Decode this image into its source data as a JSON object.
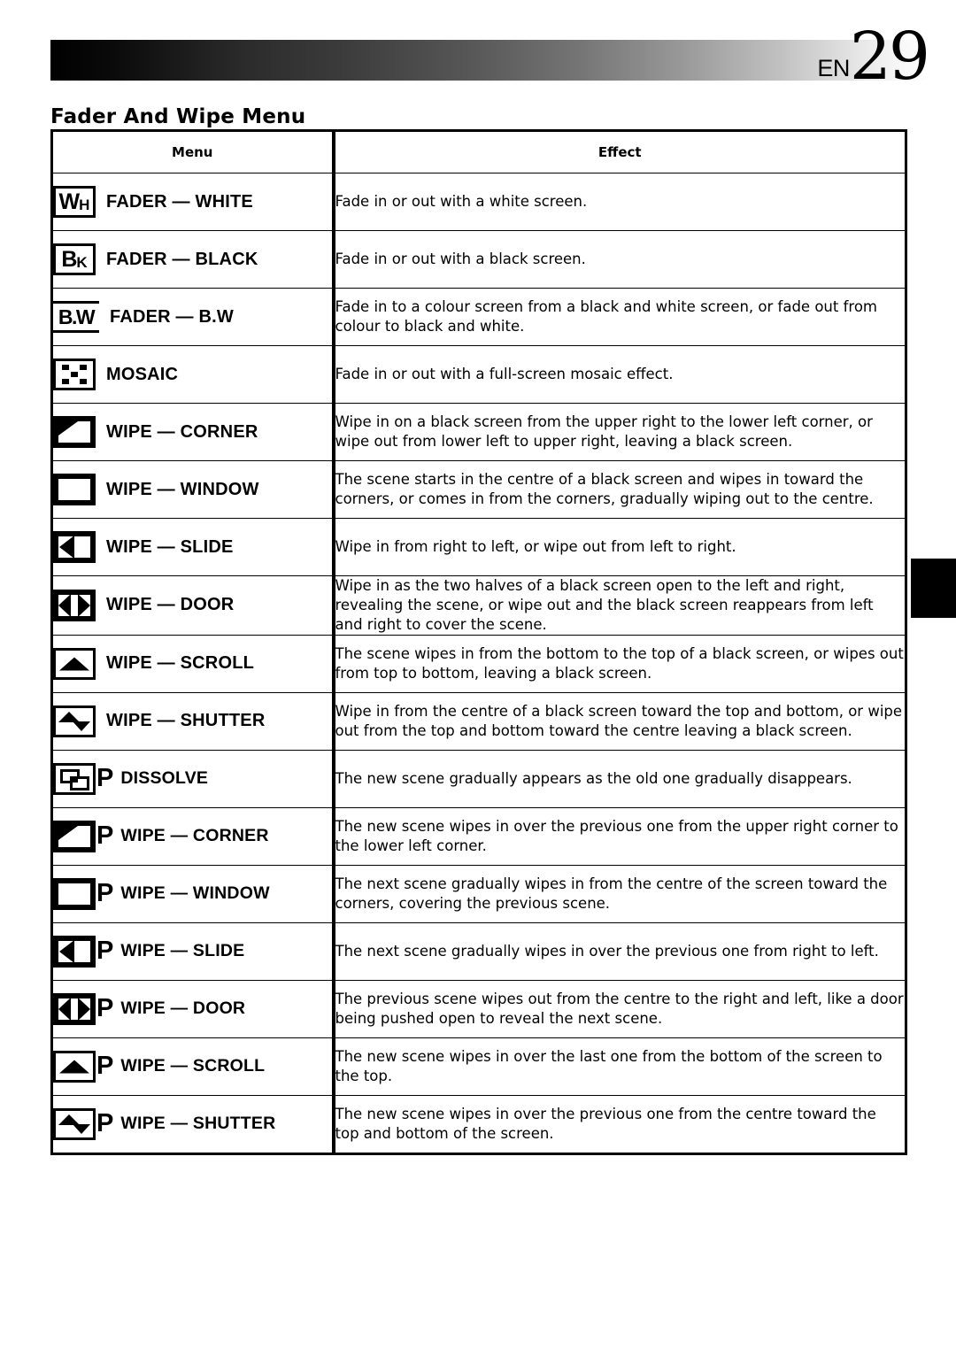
{
  "header": {
    "lang_code": "EN",
    "page_number": "29"
  },
  "section_title": "Fader And Wipe Menu",
  "table": {
    "columns": {
      "menu": "Menu",
      "effect": "Effect"
    },
    "rows": [
      {
        "icon": "wh-box-icon",
        "label": "FADER — WHITE",
        "effect": "Fade in or out with a white screen."
      },
      {
        "icon": "bk-box-icon",
        "label": "FADER — BLACK",
        "effect": "Fade in or out with a black screen."
      },
      {
        "icon": "bw-rules-icon",
        "label": "FADER — B.W",
        "effect": "Fade in to a colour screen from a black and white screen, or fade out from colour to black and white."
      },
      {
        "icon": "mosaic-checker-icon",
        "label": "MOSAIC",
        "effect": "Fade in or out with a full-screen mosaic effect."
      },
      {
        "icon": "wipe-corner-icon",
        "label": "WIPE — CORNER",
        "effect": "Wipe in on a black screen from the upper right to the lower left corner, or wipe out from lower left to upper right, leaving a black screen."
      },
      {
        "icon": "wipe-window-icon",
        "label": "WIPE — WINDOW",
        "effect": "The scene starts in the centre of a black screen and wipes in toward the corners, or comes in from the corners, gradually wiping out to the centre."
      },
      {
        "icon": "wipe-slide-icon",
        "label": "WIPE — SLIDE",
        "effect": "Wipe in from right to left, or wipe out from left to right."
      },
      {
        "icon": "wipe-door-icon",
        "label": "WIPE — DOOR",
        "effect": "Wipe in as the two halves of a black screen open to the left and right, revealing the scene, or wipe out and the black screen reappears from left and right to cover the scene."
      },
      {
        "icon": "wipe-scroll-icon",
        "label": "WIPE — SCROLL",
        "effect": "The scene wipes in from the bottom to the top of a black screen, or wipes out from top to bottom, leaving a black screen."
      },
      {
        "icon": "wipe-shutter-icon",
        "label": "WIPE — SHUTTER",
        "effect": "Wipe in from the centre of a black screen toward the top and bottom, or wipe out from the top and bottom toward the centre leaving a black screen."
      },
      {
        "icon": "dissolve-icon",
        "p_mark": "P",
        "label": "DISSOLVE",
        "effect": "The new scene gradually appears as the old one gradually disappears."
      },
      {
        "icon": "wipe-corner-icon",
        "p_mark": "P",
        "label": "WIPE — CORNER",
        "effect": "The new scene wipes in over the previous one from the upper right corner to the lower left corner."
      },
      {
        "icon": "wipe-window-icon",
        "p_mark": "P",
        "label": "WIPE — WINDOW",
        "effect": "The next scene gradually wipes in from the centre of the screen toward the corners, covering the previous scene."
      },
      {
        "icon": "wipe-slide-icon",
        "p_mark": "P",
        "label": "WIPE — SLIDE",
        "effect": "The next scene gradually wipes in over the previous one from right to left."
      },
      {
        "icon": "wipe-door-icon",
        "p_mark": "P",
        "label": "WIPE — DOOR",
        "effect": "The previous scene wipes out from the centre to the right and left, like a door being pushed open to reveal the next scene."
      },
      {
        "icon": "wipe-scroll-icon",
        "p_mark": "P",
        "label": "WIPE — SCROLL",
        "effect": "The new scene wipes in over the last one from the bottom of the screen to the top."
      },
      {
        "icon": "wipe-shutter-icon",
        "p_mark": "P",
        "label": "WIPE — SHUTTER",
        "effect": "The new scene wipes in over the previous one from the centre toward the top and bottom of the screen."
      }
    ]
  },
  "icon_letters": {
    "wh": {
      "big": "W",
      "small": "H"
    },
    "bk": {
      "big": "B",
      "small": "K"
    },
    "bw": "B.W"
  },
  "page_tab": "black-index-tab",
  "colors": {
    "ink": "#000000",
    "paper": "#ffffff"
  }
}
